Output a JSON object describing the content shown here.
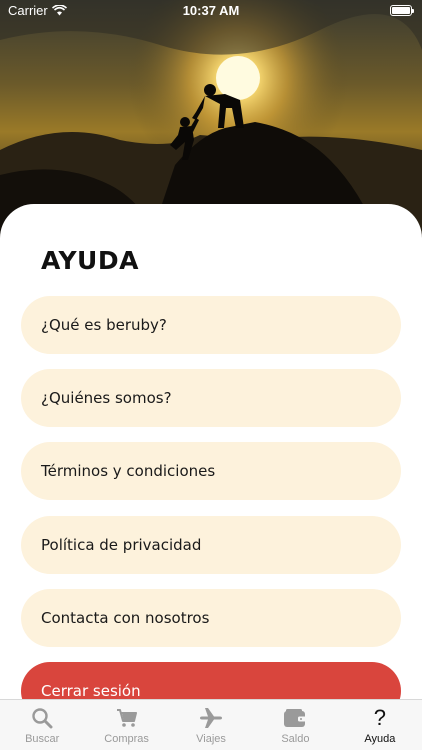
{
  "status_bar": {
    "carrier": "Carrier",
    "time": "10:37 AM"
  },
  "page": {
    "title": "AYUDA"
  },
  "menu": [
    {
      "label": "¿Qué es beruby?"
    },
    {
      "label": "¿Quiénes somos?"
    },
    {
      "label": "Términos y condiciones"
    },
    {
      "label": "Política de privacidad"
    },
    {
      "label": "Contacta con nosotros"
    }
  ],
  "logout": {
    "label": "Cerrar sesión"
  },
  "tabs": [
    {
      "label": "Buscar",
      "icon": "search-icon"
    },
    {
      "label": "Compras",
      "icon": "cart-icon"
    },
    {
      "label": "Viajes",
      "icon": "airplane-icon"
    },
    {
      "label": "Saldo",
      "icon": "wallet-icon"
    },
    {
      "label": "Ayuda",
      "icon": "question-icon",
      "active": true
    }
  ],
  "colors": {
    "menu_bg": "#fdf2dc",
    "logout_bg": "#d9453d",
    "tab_active": "#111111",
    "tab_inactive": "#9a9a9a"
  }
}
